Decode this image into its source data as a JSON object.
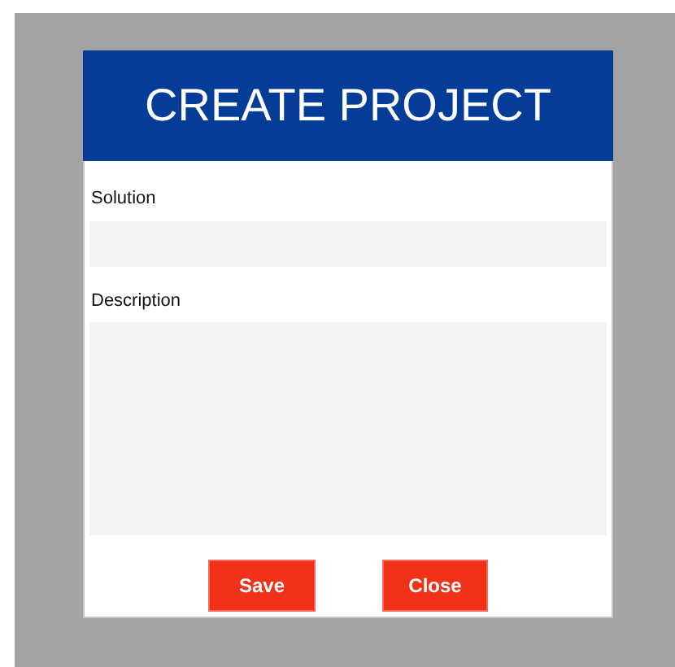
{
  "dialog": {
    "title": "CREATE PROJECT",
    "fields": [
      {
        "label": "Solution",
        "kind": "text"
      },
      {
        "label": "Description",
        "kind": "textarea"
      }
    ],
    "buttons": [
      "Save",
      "Close"
    ]
  }
}
